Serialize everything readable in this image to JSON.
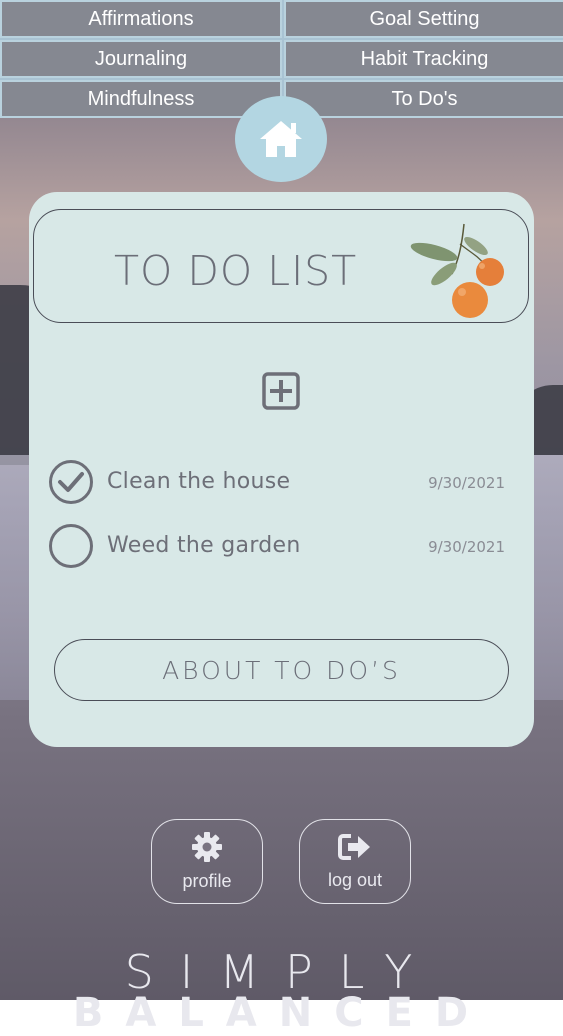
{
  "nav": {
    "items": [
      {
        "label": "Affirmations"
      },
      {
        "label": "Goal Setting"
      },
      {
        "label": "Journaling"
      },
      {
        "label": "Habit Tracking"
      },
      {
        "label": "Mindfulness"
      },
      {
        "label": "To Do's"
      }
    ]
  },
  "home": {
    "icon": "home-icon"
  },
  "card": {
    "title": "TO DO LIST",
    "add_icon": "plus-square-icon",
    "todos": [
      {
        "text": "Clean the house",
        "date": "9/30/2021",
        "done": true
      },
      {
        "text": "Weed the garden",
        "date": "9/30/2021",
        "done": false
      }
    ],
    "about_label": "ABOUT TO DO’S"
  },
  "footer": {
    "profile_label": "profile",
    "profile_icon": "gear-icon",
    "logout_label": "log out",
    "logout_icon": "sign-out-icon"
  },
  "brand": {
    "line1": "SIMPLY",
    "line2": "BALANCED"
  },
  "colors": {
    "nav_bg": "#858891",
    "nav_border": "#b9d2de",
    "card_bg": "#d8e8e7",
    "home_bg": "#b3d6e2",
    "text_gray": "#6b6e78"
  }
}
